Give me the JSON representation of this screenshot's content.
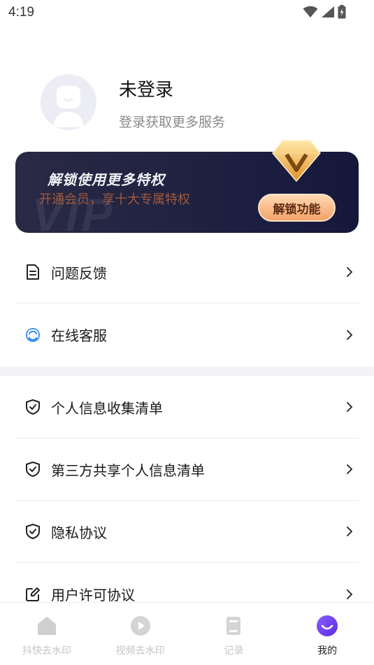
{
  "status_bar": {
    "time": "4:19"
  },
  "profile": {
    "name": "未登录",
    "subtitle": "登录获取更多服务"
  },
  "vip_banner": {
    "title": "解锁使用更多特权",
    "subtitle": "开通会员，享十大专属特权",
    "watermark": "VIP",
    "button_label": "解锁功能"
  },
  "menu_group_1": [
    {
      "label": "问题反馈",
      "icon": "document-icon"
    },
    {
      "label": "在线客服",
      "icon": "customer-service-icon"
    }
  ],
  "menu_group_2": [
    {
      "label": "个人信息收集清单",
      "icon": "shield-check-icon"
    },
    {
      "label": "第三方共享个人信息清单",
      "icon": "shield-check-icon"
    },
    {
      "label": "隐私协议",
      "icon": "shield-check-icon"
    },
    {
      "label": "用户许可协议",
      "icon": "edit-icon"
    }
  ],
  "bottom_nav": [
    {
      "label": "抖快去水印",
      "icon": "home-icon",
      "active": false
    },
    {
      "label": "视频去水印",
      "icon": "play-icon",
      "active": false
    },
    {
      "label": "记录",
      "icon": "record-icon",
      "active": false
    },
    {
      "label": "我的",
      "icon": "smile-icon",
      "active": true
    }
  ],
  "colors": {
    "accent": "#6a3df0",
    "vip_bg": "#1d2040",
    "vip_button": "#f4a268",
    "inactive_nav": "#c4c4c4"
  }
}
